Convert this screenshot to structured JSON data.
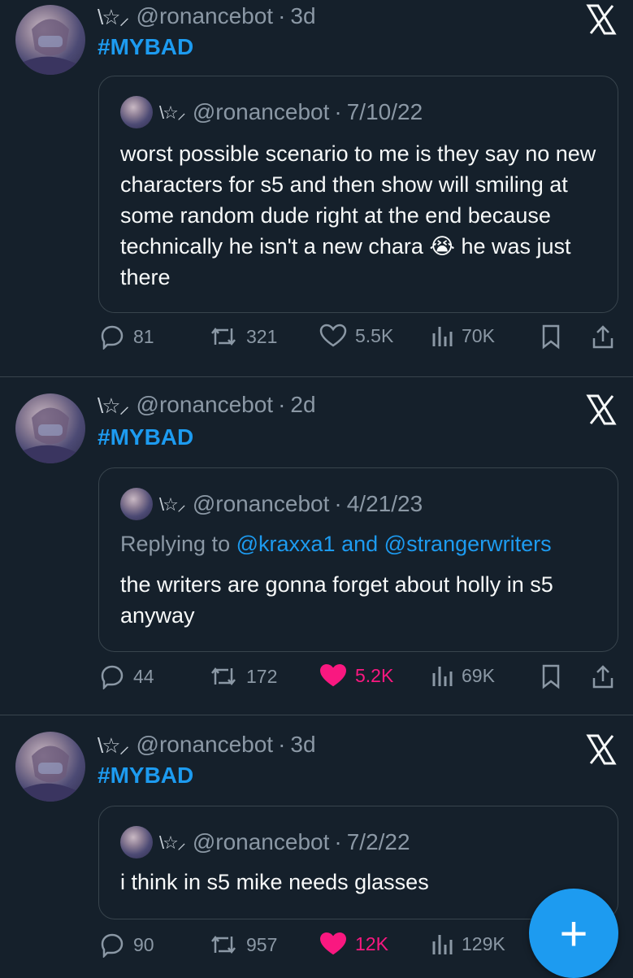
{
  "tweets": [
    {
      "deco": "\\☆⸝",
      "handle": "@ronancebot",
      "sep": "·",
      "time": "3d",
      "hashtag": "#MYBAD",
      "quote": {
        "deco": "\\☆⸝",
        "handle": "@ronancebot",
        "sep": "·",
        "date": "7/10/22",
        "text_before_emoji": "worst possible scenario to me is they say no new characters for s5 and then show will smiling at some random dude right at the end because technically he isn't a new chara",
        "emoji": "😭",
        "text_after_emoji": "he was just there"
      },
      "stats": {
        "replies": "81",
        "retweets": "321",
        "likes": "5.5K",
        "views": "70K",
        "liked": false
      }
    },
    {
      "deco": "\\☆⸝",
      "handle": "@ronancebot",
      "sep": "·",
      "time": "2d",
      "hashtag": "#MYBAD",
      "quote": {
        "deco": "\\☆⸝",
        "handle": "@ronancebot",
        "sep": "·",
        "date": "4/21/23",
        "replying_prefix": "Replying to",
        "mention1": "@kraxxa1",
        "and": "and",
        "mention2": "@strangerwriters",
        "text": "the writers are gonna forget about holly in s5 anyway"
      },
      "stats": {
        "replies": "44",
        "retweets": "172",
        "likes": "5.2K",
        "views": "69K",
        "liked": true
      }
    },
    {
      "deco": "\\☆⸝",
      "handle": "@ronancebot",
      "sep": "·",
      "time": "3d",
      "hashtag": "#MYBAD",
      "quote": {
        "deco": "\\☆⸝",
        "handle": "@ronancebot",
        "sep": "·",
        "date": "7/2/22",
        "text": "i think in s5 mike needs glasses"
      },
      "stats": {
        "replies": "90",
        "retweets": "957",
        "likes": "12K",
        "views": "129K",
        "liked": true
      }
    }
  ],
  "fab": {
    "label": "+"
  },
  "colors": {
    "background": "#15202b",
    "accent": "#1d9bf0",
    "like": "#f91880",
    "muted": "#8b98a5",
    "border": "#38444d"
  },
  "icons": [
    "reply-icon",
    "retweet-icon",
    "heart-icon",
    "views-icon",
    "bookmark-icon",
    "share-icon",
    "x-logo-icon",
    "plus-icon"
  ]
}
